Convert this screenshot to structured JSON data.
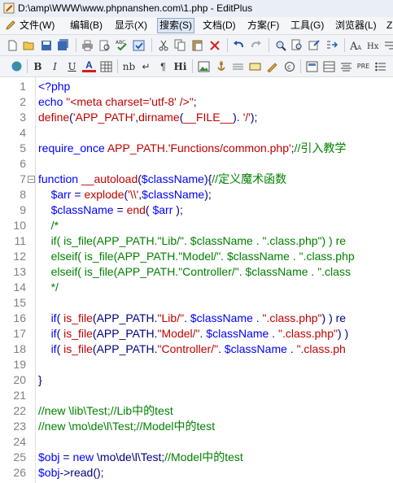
{
  "window": {
    "title": "D:\\amp\\WWW\\www.phpnanshen.com\\1.php - EditPlus"
  },
  "menu": [
    {
      "label": "文件(W)"
    },
    {
      "label": "编辑(B)"
    },
    {
      "label": "显示(X)"
    },
    {
      "label": "搜索(S)",
      "active": true
    },
    {
      "label": "文档(D)"
    },
    {
      "label": "方案(F)"
    },
    {
      "label": "工具(G)"
    },
    {
      "label": "浏览器(L)"
    },
    {
      "label": "Z"
    }
  ],
  "toolbar1_icons": [
    "new-file-icon",
    "open-folder-icon",
    "save-icon",
    "save-all-icon",
    "print-icon",
    "print-preview-icon",
    "spell-check-icon",
    "cut-icon",
    "copy-icon",
    "paste-icon",
    "delete-icon",
    "undo-icon",
    "redo-icon",
    "find-icon",
    "replace-icon",
    "goto-icon",
    "indent-icon",
    "hex-icon",
    "wrap-icon"
  ],
  "toolbar2": {
    "bold": "B",
    "italic": "I",
    "underline": "U",
    "font_color": "A",
    "nbsp": "nb",
    "break": "↵",
    "paragraph": "¶",
    "heading": "Hi",
    "pre": "PRE"
  },
  "lines": [
    {
      "n": "1",
      "t": [
        [
          "kw",
          "<?php"
        ]
      ]
    },
    {
      "n": "2",
      "t": [
        [
          "kw",
          "echo "
        ],
        [
          "str",
          "\"<meta charset='utf-8' />\""
        ],
        [
          "txt",
          ";"
        ]
      ]
    },
    {
      "n": "3",
      "t": [
        [
          "str",
          "define"
        ],
        [
          "txt",
          "("
        ],
        [
          "str",
          "'APP_PATH'"
        ],
        [
          "txt",
          ","
        ],
        [
          "str",
          "dirname"
        ],
        [
          "txt",
          "("
        ],
        [
          "str",
          "__FILE__"
        ],
        [
          "txt",
          "). "
        ],
        [
          "str",
          "'/'"
        ],
        [
          "txt",
          ");"
        ]
      ]
    },
    {
      "n": "4",
      "t": []
    },
    {
      "n": "5",
      "t": [
        [
          "kw",
          "require_once "
        ],
        [
          "str",
          "APP_PATH."
        ],
        [
          "str",
          "'Functions/common.php'"
        ],
        [
          "txt",
          ";"
        ],
        [
          "com",
          "//引入教学"
        ]
      ]
    },
    {
      "n": "6",
      "t": []
    },
    {
      "n": "7",
      "fold": true,
      "t": [
        [
          "kw",
          "function "
        ],
        [
          "str",
          "__autoload"
        ],
        [
          "txt",
          "("
        ],
        [
          "var",
          "$className"
        ],
        [
          "txt",
          ")"
        ],
        [
          "txt",
          "{"
        ],
        [
          "com",
          "//定义魔术函数"
        ]
      ]
    },
    {
      "n": "8",
      "t": [
        [
          "txt",
          "    "
        ],
        [
          "var",
          "$arr"
        ],
        [
          "txt",
          " = "
        ],
        [
          "str",
          "explode"
        ],
        [
          "txt",
          "("
        ],
        [
          "str",
          "'\\\\'"
        ],
        [
          "txt",
          ","
        ],
        [
          "var",
          "$className"
        ],
        [
          "txt",
          ");"
        ]
      ]
    },
    {
      "n": "9",
      "t": [
        [
          "txt",
          "    "
        ],
        [
          "var",
          "$className"
        ],
        [
          "txt",
          " = "
        ],
        [
          "str",
          "end"
        ],
        [
          "txt",
          "( "
        ],
        [
          "var",
          "$arr"
        ],
        [
          "txt",
          " );"
        ]
      ]
    },
    {
      "n": "10",
      "t": [
        [
          "txt",
          "    "
        ],
        [
          "com",
          "/*"
        ]
      ]
    },
    {
      "n": "11",
      "t": [
        [
          "txt",
          "    "
        ],
        [
          "com",
          "if( is_file(APP_PATH.\"Lib/\". $className . \".class.php\") ) re"
        ]
      ]
    },
    {
      "n": "12",
      "t": [
        [
          "txt",
          "    "
        ],
        [
          "com",
          "elseif( is_file(APP_PATH.\"Model/\". $className . \".class.php"
        ]
      ]
    },
    {
      "n": "13",
      "t": [
        [
          "txt",
          "    "
        ],
        [
          "com",
          "elseif( is_file(APP_PATH.\"Controller/\". $className . \".class"
        ]
      ]
    },
    {
      "n": "14",
      "t": [
        [
          "txt",
          "    "
        ],
        [
          "com",
          "*/"
        ]
      ]
    },
    {
      "n": "15",
      "t": []
    },
    {
      "n": "16",
      "t": [
        [
          "txt",
          "    "
        ],
        [
          "kw",
          "if"
        ],
        [
          "txt",
          "( "
        ],
        [
          "str",
          "is_file"
        ],
        [
          "txt",
          "(APP_PATH."
        ],
        [
          "str",
          "\"Lib/\""
        ],
        [
          "txt",
          ". "
        ],
        [
          "var",
          "$className"
        ],
        [
          "txt",
          " . "
        ],
        [
          "str",
          "\".class.php\""
        ],
        [
          "txt",
          ") ) re"
        ]
      ]
    },
    {
      "n": "17",
      "t": [
        [
          "txt",
          "    "
        ],
        [
          "kw",
          "if"
        ],
        [
          "txt",
          "( "
        ],
        [
          "str",
          "is_file"
        ],
        [
          "txt",
          "(APP_PATH."
        ],
        [
          "str",
          "\"Model/\""
        ],
        [
          "txt",
          ". "
        ],
        [
          "var",
          "$className"
        ],
        [
          "txt",
          " . "
        ],
        [
          "str",
          "\".class.php\""
        ],
        [
          "txt",
          ") )"
        ]
      ]
    },
    {
      "n": "18",
      "t": [
        [
          "txt",
          "    "
        ],
        [
          "kw",
          "if"
        ],
        [
          "txt",
          "( "
        ],
        [
          "str",
          "is_file"
        ],
        [
          "txt",
          "(APP_PATH."
        ],
        [
          "str",
          "\"Controller/\""
        ],
        [
          "txt",
          ". "
        ],
        [
          "var",
          "$className"
        ],
        [
          "txt",
          " . "
        ],
        [
          "str",
          "\".class.ph"
        ]
      ]
    },
    {
      "n": "19",
      "t": []
    },
    {
      "n": "20",
      "t": [
        [
          "txt",
          "}"
        ]
      ]
    },
    {
      "n": "21",
      "t": []
    },
    {
      "n": "22",
      "t": [
        [
          "com",
          "//new \\lib\\Test;//Lib中的test"
        ]
      ]
    },
    {
      "n": "23",
      "t": [
        [
          "com",
          "//new \\mo\\de\\l\\Test;//Model中的test"
        ]
      ]
    },
    {
      "n": "24",
      "t": []
    },
    {
      "n": "25",
      "t": [
        [
          "var",
          "$obj"
        ],
        [
          "txt",
          " = "
        ],
        [
          "kw",
          "new "
        ],
        [
          "txt",
          "\\mo\\de\\l\\Test;"
        ],
        [
          "com",
          "//Model中的test"
        ]
      ]
    },
    {
      "n": "26",
      "t": [
        [
          "var",
          "$obj"
        ],
        [
          "txt",
          "->read();"
        ]
      ]
    }
  ]
}
